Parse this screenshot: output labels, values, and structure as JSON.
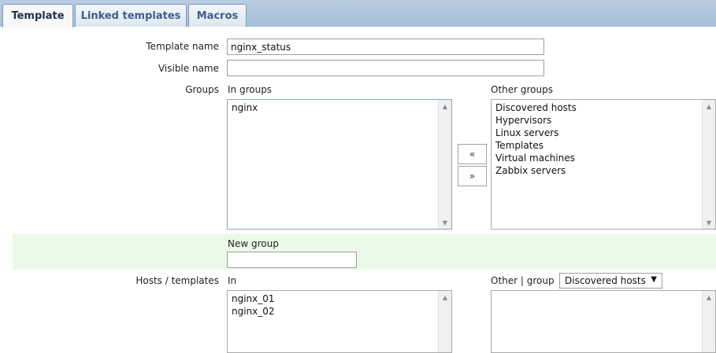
{
  "tabs": [
    {
      "label": "Template",
      "active": true
    },
    {
      "label": "Linked templates",
      "active": false
    },
    {
      "label": "Macros",
      "active": false
    }
  ],
  "form": {
    "template_name_label": "Template name",
    "template_name_value": "nginx_status",
    "visible_name_label": "Visible name",
    "visible_name_value": "",
    "groups_label": "Groups",
    "in_groups_label": "In groups",
    "in_groups": [
      "nginx"
    ],
    "other_groups_label": "Other groups",
    "other_groups": [
      "Discovered hosts",
      "Hypervisors",
      "Linux servers",
      "Templates",
      "Virtual machines",
      "Zabbix servers"
    ],
    "move_left_label": "«",
    "move_right_label": "»",
    "new_group_label": "New group",
    "new_group_value": "",
    "hosts_templates_label": "Hosts / templates",
    "in_label": "In",
    "in_hosts": [
      "nginx_01",
      "nginx_02"
    ],
    "other_group_label": "Other | group",
    "group_select_value": "Discovered hosts"
  },
  "colors": {
    "tab_text": "#3f5f8a",
    "tab_bar": "#b9cce0",
    "new_group_band": "#ebfae8"
  }
}
